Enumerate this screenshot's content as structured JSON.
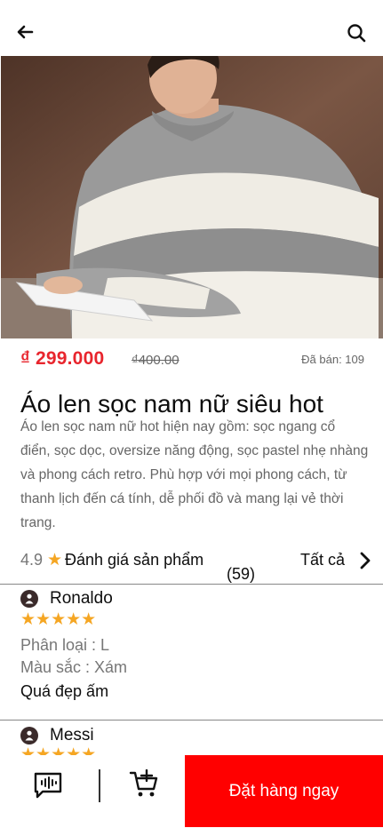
{
  "header": {
    "back_icon": "arrow-left-icon",
    "search_icon": "search-icon"
  },
  "product": {
    "image_alt": "product-photo",
    "price": "₫ 299.000",
    "old_price": "₫400.00",
    "sold": "Đã bán: 109",
    "title": "Áo len sọc nam nữ siêu hot",
    "description": "Áo len sọc nam nữ hot hiện nay gồm: sọc ngang cổ điển, sọc dọc, oversize năng động, sọc pastel nhẹ nhàng và phong cách retro. Phù hợp với mọi phong cách, từ thanh lịch đến cá tính, dễ phối đồ và mang lại vẻ thời trang."
  },
  "rating": {
    "score": "4.9",
    "star": "★",
    "label": "Đánh giá sản phẩm",
    "count": "(59)",
    "see_all": "Tất cả"
  },
  "reviews": [
    {
      "name": "Ronaldo",
      "stars": "★★★★★",
      "variant": "Phân loại : L",
      "color": "Màu sắc : Xám",
      "comment": "Quá đẹp ấm"
    },
    {
      "name": "Messi",
      "stars": "★★★★★"
    }
  ],
  "bottom_bar": {
    "chat_icon": "chat-icon",
    "cart_icon": "add-to-cart-icon",
    "order_label": "Đặt hàng ngay"
  },
  "colors": {
    "accent": "#ff0000",
    "price": "#e8252d",
    "star": "#f5a623"
  }
}
